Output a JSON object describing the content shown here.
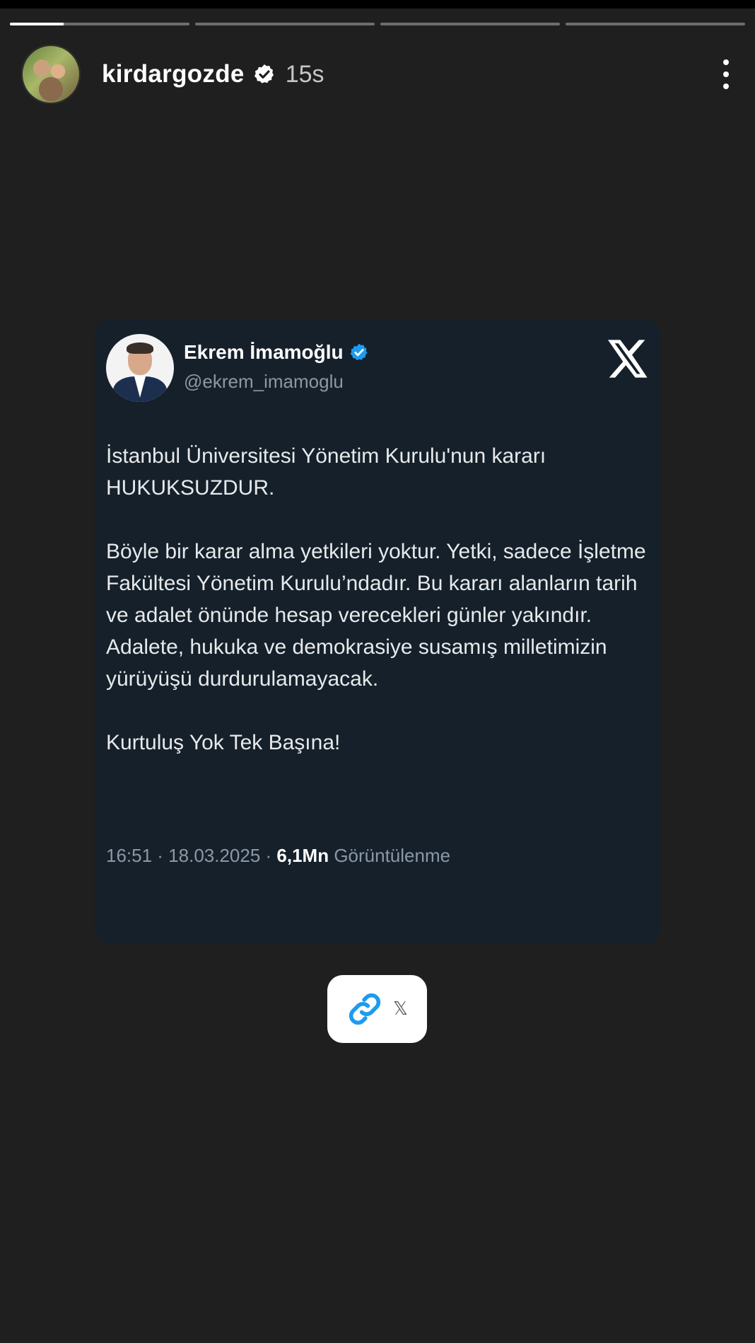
{
  "story": {
    "username": "kirdargozde",
    "time": "15s",
    "progress": [
      0.3,
      0,
      0,
      0
    ]
  },
  "tweet": {
    "name": "Ekrem İmamoğlu",
    "handle": "@ekrem_imamoglu",
    "paragraphs": [
      "İstanbul Üniversitesi Yönetim Kurulu'nun kararı HUKUKSUZDUR.",
      "Böyle bir karar alma yetkileri yoktur. Yetki, sadece İşletme Fakültesi Yönetim Kurulu’ndadır. Bu kararı alanların tarih ve adalet önünde hesap verecekleri günler yakındır. Adalete, hukuka ve demokrasiye susamış milletimizin yürüyüşü durdurulamayacak.",
      "Kurtuluş Yok Tek Başına!"
    ],
    "time_date": "16:51 · 18.03.2025 · ",
    "views": "6,1Mn",
    "views_label": " Görüntülenme"
  },
  "link_sticker": {
    "label": "𝕏"
  },
  "colors": {
    "background": "#1f1f1f",
    "card": "#15202b",
    "verified_blue": "#1d9bf0",
    "muted": "#8b98a5"
  },
  "icons": {
    "verified_story": "verified-badge-icon",
    "more": "more-vertical-icon",
    "x_logo": "x-logo-icon",
    "link": "link-icon"
  }
}
